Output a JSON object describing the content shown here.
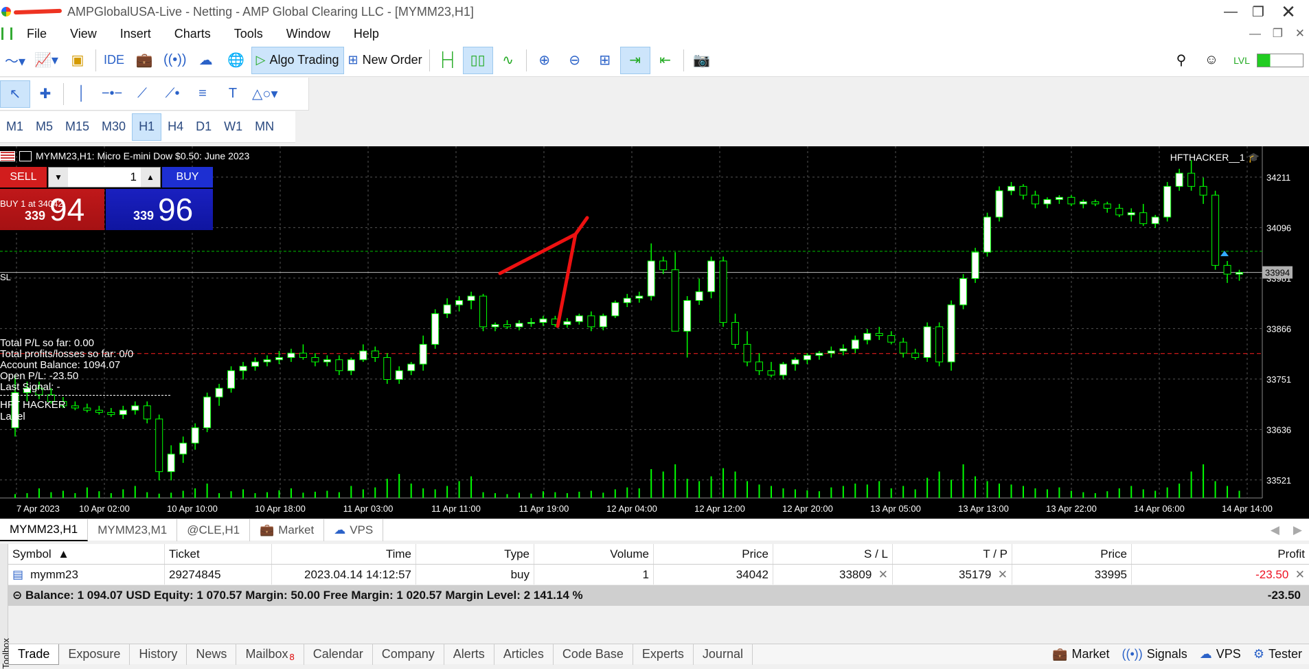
{
  "window": {
    "title": "AMPGlobalUSA-Live - Netting - AMP Global Clearing LLC - [MYMM23,H1]"
  },
  "menu": [
    "File",
    "View",
    "Insert",
    "Charts",
    "Tools",
    "Window",
    "Help"
  ],
  "toolbar": {
    "ide_label": "IDE",
    "algo_label": "Algo Trading",
    "new_order_label": "New Order"
  },
  "timeframes": [
    "M1",
    "M5",
    "M15",
    "M30",
    "H1",
    "H4",
    "D1",
    "W1",
    "MN"
  ],
  "active_timeframe": "H1",
  "chart": {
    "header": "MYMM23,H1:  Micro E-mini Dow $0.50: June 2023",
    "ea_name": "HFTHACKER__1",
    "sell_label": "SELL",
    "buy_label": "BUY",
    "lot": "1",
    "sell_small": "339",
    "sell_big": "94",
    "buy_small": "339",
    "buy_big": "96",
    "buy_line_label": "BUY 1 at 34042",
    "sl_label": "SL",
    "stats": [
      "Total P/L so far: 0.00",
      "Total profits/losses so far: 0/0",
      "Account Balance: 1094.07",
      "Open P/L: -23.50",
      "Last Signal:  -"
    ],
    "ea_label_1": "HFT HACKER",
    "ea_label_2": "Label",
    "price_label": "33994"
  },
  "chart_data": {
    "type": "candlestick",
    "y_ticks": [
      "34211",
      "34096",
      "33981",
      "33866",
      "33751",
      "33636",
      "33521"
    ],
    "x_ticks": [
      "7 Apr 2023",
      "10 Apr 02:00",
      "10 Apr 10:00",
      "10 Apr 18:00",
      "11 Apr 03:00",
      "11 Apr 11:00",
      "11 Apr 19:00",
      "12 Apr 04:00",
      "12 Apr 12:00",
      "12 Apr 20:00",
      "13 Apr 05:00",
      "13 Apr 13:00",
      "13 Apr 22:00",
      "14 Apr 06:00",
      "14 Apr 14:00"
    ],
    "ylim": [
      33480,
      34250
    ],
    "buy_level": 34042,
    "sl_level": 33809,
    "bid_level": 33994,
    "grid": true,
    "ohlc": [
      [
        33640,
        33760,
        33620,
        33720
      ],
      [
        33720,
        33745,
        33700,
        33730
      ],
      [
        33730,
        33745,
        33705,
        33715
      ],
      [
        33715,
        33730,
        33695,
        33700
      ],
      [
        33700,
        33710,
        33685,
        33690
      ],
      [
        33690,
        33700,
        33680,
        33685
      ],
      [
        33685,
        33695,
        33675,
        33680
      ],
      [
        33680,
        33690,
        33670,
        33675
      ],
      [
        33675,
        33685,
        33665,
        33670
      ],
      [
        33670,
        33690,
        33660,
        33680
      ],
      [
        33680,
        33700,
        33670,
        33690
      ],
      [
        33690,
        33700,
        33650,
        33660
      ],
      [
        33660,
        33670,
        33520,
        33540
      ],
      [
        33540,
        33600,
        33520,
        33580
      ],
      [
        33580,
        33620,
        33560,
        33605
      ],
      [
        33605,
        33650,
        33590,
        33640
      ],
      [
        33640,
        33720,
        33630,
        33710
      ],
      [
        33710,
        33740,
        33690,
        33730
      ],
      [
        33730,
        33780,
        33720,
        33770
      ],
      [
        33770,
        33790,
        33750,
        33780
      ],
      [
        33780,
        33800,
        33770,
        33790
      ],
      [
        33790,
        33805,
        33780,
        33795
      ],
      [
        33795,
        33815,
        33785,
        33800
      ],
      [
        33800,
        33820,
        33790,
        33810
      ],
      [
        33810,
        33830,
        33795,
        33800
      ],
      [
        33800,
        33810,
        33780,
        33790
      ],
      [
        33790,
        33805,
        33780,
        33795
      ],
      [
        33795,
        33805,
        33760,
        33770
      ],
      [
        33770,
        33800,
        33760,
        33795
      ],
      [
        33795,
        33830,
        33790,
        33815
      ],
      [
        33815,
        33825,
        33790,
        33800
      ],
      [
        33800,
        33810,
        33740,
        33750
      ],
      [
        33750,
        33780,
        33740,
        33770
      ],
      [
        33770,
        33790,
        33760,
        33785
      ],
      [
        33785,
        33850,
        33770,
        33830
      ],
      [
        33830,
        33910,
        33820,
        33900
      ],
      [
        33900,
        33935,
        33890,
        33920
      ],
      [
        33920,
        33940,
        33905,
        33930
      ],
      [
        33930,
        33950,
        33910,
        33940
      ],
      [
        33940,
        33945,
        33860,
        33870
      ],
      [
        33870,
        33880,
        33860,
        33875
      ],
      [
        33875,
        33885,
        33865,
        33870
      ],
      [
        33870,
        33885,
        33862,
        33878
      ],
      [
        33878,
        33890,
        33870,
        33880
      ],
      [
        33880,
        33895,
        33872,
        33888
      ],
      [
        33888,
        33895,
        33870,
        33875
      ],
      [
        33875,
        33890,
        33868,
        33882
      ],
      [
        33882,
        33900,
        33875,
        33895
      ],
      [
        33895,
        33905,
        33860,
        33870
      ],
      [
        33870,
        33900,
        33862,
        33895
      ],
      [
        33895,
        33930,
        33890,
        33925
      ],
      [
        33925,
        33945,
        33915,
        33935
      ],
      [
        33935,
        33950,
        33925,
        33940
      ],
      [
        33940,
        34060,
        33930,
        34020
      ],
      [
        34020,
        34030,
        33990,
        34000
      ],
      [
        34000,
        34040,
        33860,
        33860
      ],
      [
        33860,
        33940,
        33800,
        33930
      ],
      [
        33930,
        33980,
        33920,
        33950
      ],
      [
        33950,
        34030,
        33935,
        34020
      ],
      [
        34020,
        34030,
        33870,
        33880
      ],
      [
        33880,
        33900,
        33820,
        33830
      ],
      [
        33830,
        33860,
        33780,
        33790
      ],
      [
        33790,
        33810,
        33760,
        33770
      ],
      [
        33770,
        33790,
        33755,
        33760
      ],
      [
        33760,
        33790,
        33750,
        33785
      ],
      [
        33785,
        33800,
        33770,
        33795
      ],
      [
        33795,
        33810,
        33785,
        33805
      ],
      [
        33805,
        33815,
        33795,
        33810
      ],
      [
        33810,
        33825,
        33800,
        33815
      ],
      [
        33815,
        33830,
        33805,
        33820
      ],
      [
        33820,
        33850,
        33810,
        33840
      ],
      [
        33840,
        33865,
        33830,
        33855
      ],
      [
        33855,
        33870,
        33840,
        33850
      ],
      [
        33850,
        33860,
        33830,
        33835
      ],
      [
        33835,
        33845,
        33800,
        33810
      ],
      [
        33810,
        33820,
        33795,
        33800
      ],
      [
        33800,
        33880,
        33790,
        33870
      ],
      [
        33870,
        33880,
        33780,
        33790
      ],
      [
        33790,
        33930,
        33770,
        33920
      ],
      [
        33920,
        33990,
        33910,
        33980
      ],
      [
        33980,
        34050,
        33970,
        34040
      ],
      [
        34040,
        34130,
        34030,
        34120
      ],
      [
        34120,
        34190,
        34110,
        34180
      ],
      [
        34180,
        34200,
        34170,
        34190
      ],
      [
        34190,
        34195,
        34160,
        34170
      ],
      [
        34170,
        34180,
        34140,
        34150
      ],
      [
        34150,
        34165,
        34140,
        34160
      ],
      [
        34160,
        34170,
        34150,
        34165
      ],
      [
        34165,
        34170,
        34145,
        34150
      ],
      [
        34150,
        34160,
        34140,
        34155
      ],
      [
        34155,
        34160,
        34145,
        34150
      ],
      [
        34150,
        34155,
        34130,
        34140
      ],
      [
        34140,
        34150,
        34120,
        34125
      ],
      [
        34125,
        34140,
        34110,
        34130
      ],
      [
        34130,
        34150,
        34100,
        34105
      ],
      [
        34105,
        34125,
        34095,
        34120
      ],
      [
        34120,
        34200,
        34110,
        34190
      ],
      [
        34190,
        34230,
        34180,
        34220
      ],
      [
        34220,
        34250,
        34180,
        34190
      ],
      [
        34190,
        34210,
        34150,
        34170
      ],
      [
        34170,
        34180,
        34000,
        34010
      ],
      [
        34010,
        34020,
        33970,
        33990
      ],
      [
        33990,
        34000,
        33975,
        33994
      ]
    ],
    "volume": [
      8,
      10,
      20,
      12,
      15,
      10,
      22,
      14,
      10,
      18,
      25,
      12,
      9,
      11,
      15,
      20,
      30,
      10,
      14,
      18,
      10,
      12,
      16,
      20,
      11,
      13,
      15,
      12,
      25,
      18,
      22,
      40,
      50,
      30,
      20,
      18,
      25,
      35,
      45,
      12,
      10,
      8,
      11,
      9,
      14,
      12,
      10,
      13,
      15,
      11,
      18,
      22,
      20,
      60,
      55,
      70,
      40,
      35,
      45,
      62,
      55,
      35,
      28,
      25,
      20,
      18,
      16,
      14,
      22,
      25,
      30,
      28,
      35,
      20,
      25,
      18,
      42,
      55,
      38,
      70,
      45,
      35,
      30,
      28,
      25,
      20,
      18,
      22,
      15,
      12,
      10,
      14,
      20,
      25,
      18,
      15,
      22,
      30,
      55,
      70,
      35,
      25,
      15
    ]
  },
  "chart_tabs": [
    "MYMM23,H1",
    "MYMM23,M1",
    "@CLE,H1",
    "Market",
    "VPS"
  ],
  "positions": {
    "headers": [
      "Symbol",
      "Ticket",
      "Time",
      "Type",
      "Volume",
      "Price",
      "S / L",
      "T / P",
      "Price",
      "Profit"
    ],
    "rows": [
      [
        "mymm23",
        "29274845",
        "2023.04.14 14:12:57",
        "buy",
        "1",
        "34042",
        "33809",
        "35179",
        "33995",
        "-23.50"
      ]
    ],
    "summary": "Balance: 1 094.07 USD  Equity: 1 070.57  Margin: 50.00  Free Margin: 1 020.57  Margin Level: 2 141.14 %",
    "summary_total": "-23.50"
  },
  "toolbox_label": "Toolbox",
  "bottom_tabs": [
    "Trade",
    "Exposure",
    "History",
    "News",
    "Mailbox",
    "Calendar",
    "Company",
    "Alerts",
    "Articles",
    "Code Base",
    "Experts",
    "Journal"
  ],
  "mailbox_badge": "8",
  "status": [
    "Market",
    "Signals",
    "VPS",
    "Tester"
  ],
  "colors": {
    "bull": "#ffffff",
    "bear": "#000000",
    "wick": "#00ff00",
    "sl_line": "#ff2020",
    "buy_line": "#00c000",
    "loss": "#e11122"
  }
}
